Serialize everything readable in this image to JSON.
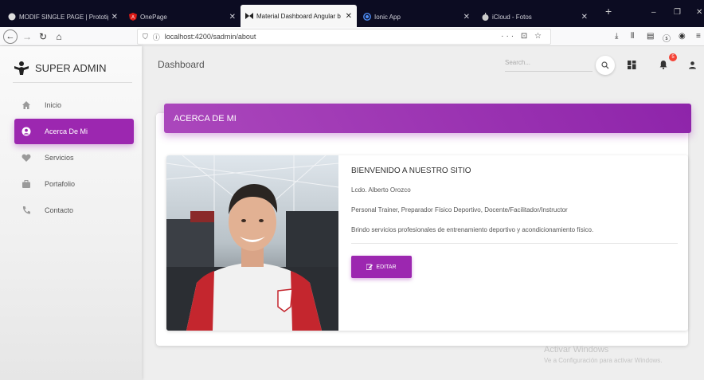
{
  "tabs": [
    {
      "title": "MODIF SINGLE PAGE | Prototip",
      "icon": "figma-icon",
      "active": false
    },
    {
      "title": "OnePage",
      "icon": "angular-icon",
      "active": false
    },
    {
      "title": "Material Dashboard Angular b",
      "icon": "bowtie-icon",
      "active": true
    },
    {
      "title": "Ionic App",
      "icon": "ionic-icon",
      "active": false
    },
    {
      "title": "iCloud - Fotos",
      "icon": "apple-icon",
      "active": false
    }
  ],
  "browser": {
    "url": "localhost:4200/sadmin/about",
    "url_actions": "··· ⊡ ☆"
  },
  "sidebar": {
    "brand": "SUPER ADMIN",
    "items": [
      {
        "label": "Inicio",
        "icon": "home-icon",
        "active": false
      },
      {
        "label": "Acerca De Mi",
        "icon": "user-icon",
        "active": true
      },
      {
        "label": "Servicios",
        "icon": "heart-icon",
        "active": false
      },
      {
        "label": "Portafolio",
        "icon": "briefcase-icon",
        "active": false
      },
      {
        "label": "Contacto",
        "icon": "phone-icon",
        "active": false
      }
    ]
  },
  "topbar": {
    "title": "Dashboard",
    "search_placeholder": "Search...",
    "notification_count": "5"
  },
  "card": {
    "header": "ACERCA DE MI",
    "welcome": "BIENVENIDO A NUESTRO SITIO",
    "name": "Lcdo. Alberto Orozco",
    "roles": "Personal Trainer, Preparador Físico Deportivo, Docente/Facilitador/Instructor",
    "description": "Brindo servicios profesionales de entrenamiento deportivo y acondicionamiento físico.",
    "edit_label": "EDITAR"
  },
  "watermark": {
    "line1": "Activar Windows",
    "line2": "Ve a Configuración para activar Windows."
  },
  "colors": {
    "accent": "#9c27b0",
    "badge": "#f44336"
  }
}
